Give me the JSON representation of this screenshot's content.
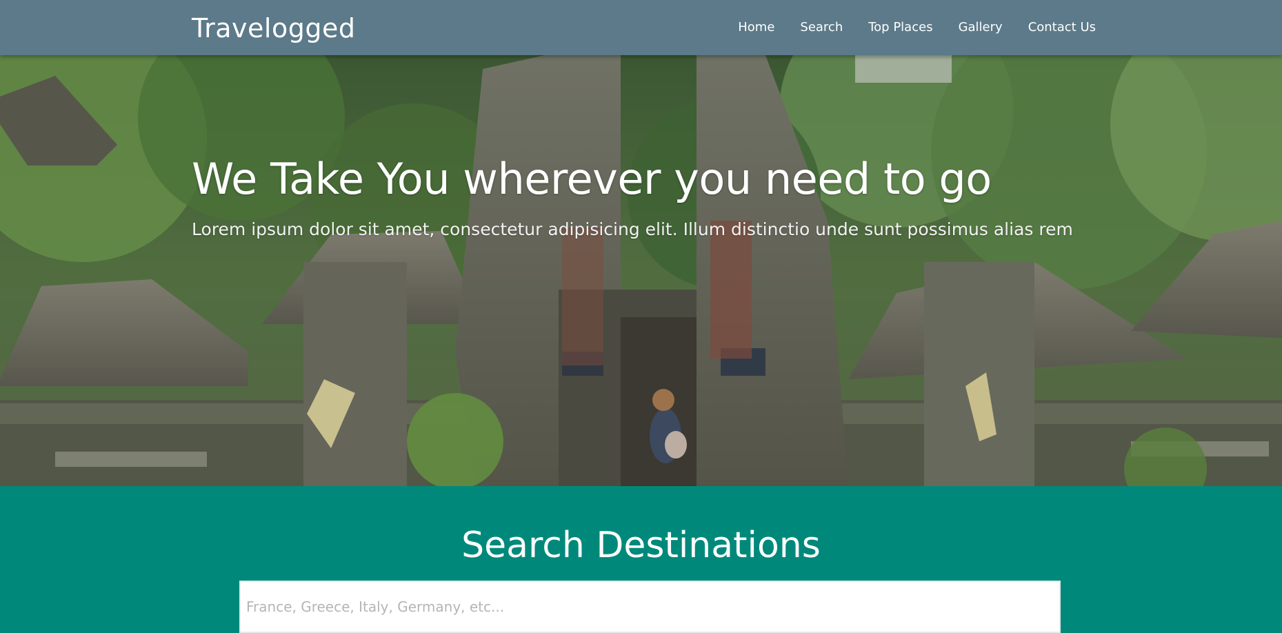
{
  "navbar": {
    "brand": "Travelogged",
    "links": [
      "Home",
      "Search",
      "Top Places",
      "Gallery",
      "Contact Us"
    ]
  },
  "hero": {
    "title": "We Take You wherever you need to go",
    "subtitle": "Lorem ipsum dolor sit amet, consectetur adipisicing elit. Illum distinctio unde sunt possimus alias rem"
  },
  "search": {
    "title": "Search Destinations",
    "placeholder": "France, Greece, Italy, Germany, etc...",
    "value": ""
  },
  "colors": {
    "navbar": "#5c7a89",
    "search_section": "#00897b",
    "text": "#ffffff"
  }
}
